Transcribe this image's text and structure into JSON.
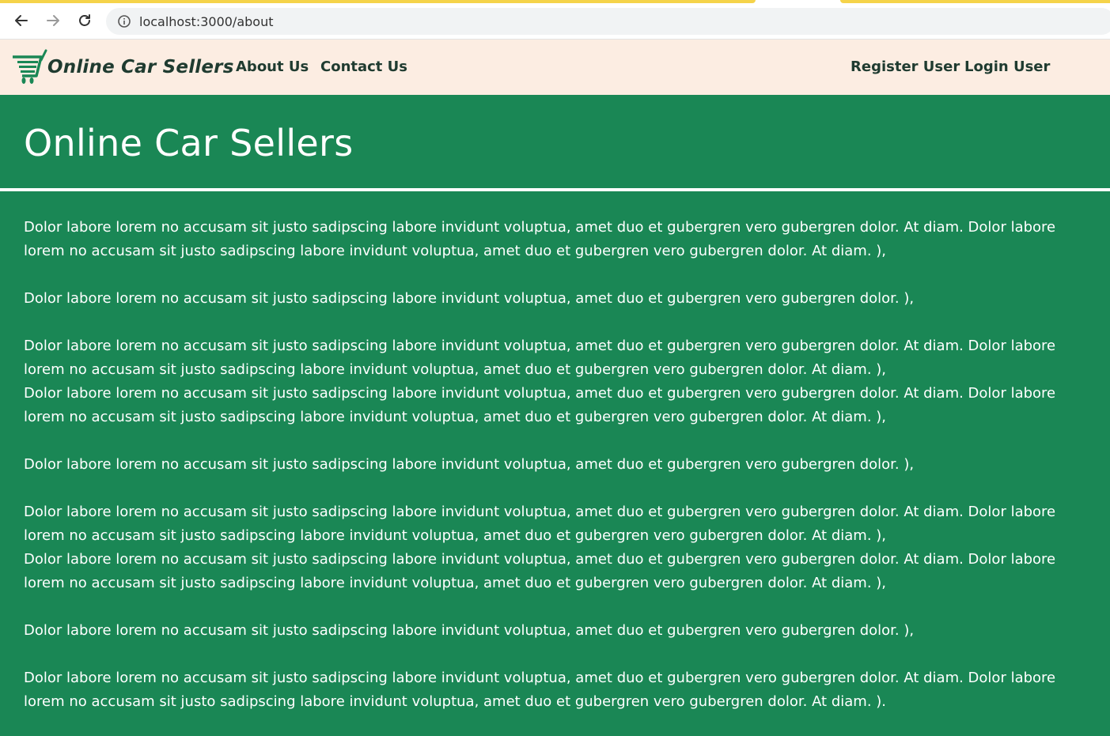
{
  "browser": {
    "url": "localhost:3000/about"
  },
  "navbar": {
    "brand": "Online Car Sellers",
    "links": {
      "about": "About Us",
      "contact": "Contact Us",
      "register": "Register User",
      "login": "Login User"
    }
  },
  "hero": {
    "title": "Online Car Sellers"
  },
  "content": {
    "paragraphs": [
      "Dolor labore lorem no accusam sit justo sadipscing labore invidunt voluptua, amet duo et gubergren vero gubergren dolor. At diam. Dolor labore lorem no accusam sit justo sadipscing labore invidunt voluptua, amet duo et gubergren vero gubergren dolor. At diam. ),",
      "Dolor labore lorem no accusam sit justo sadipscing labore invidunt voluptua, amet duo et gubergren vero gubergren dolor. ),",
      "Dolor labore lorem no accusam sit justo sadipscing labore invidunt voluptua, amet duo et gubergren vero gubergren dolor. At diam. Dolor labore lorem no accusam sit justo sadipscing labore invidunt voluptua, amet duo et gubergren vero gubergren dolor. At diam. ),",
      "Dolor labore lorem no accusam sit justo sadipscing labore invidunt voluptua, amet duo et gubergren vero gubergren dolor. At diam. Dolor labore lorem no accusam sit justo sadipscing labore invidunt voluptua, amet duo et gubergren vero gubergren dolor. At diam. ),",
      "Dolor labore lorem no accusam sit justo sadipscing labore invidunt voluptua, amet duo et gubergren vero gubergren dolor. ),",
      "Dolor labore lorem no accusam sit justo sadipscing labore invidunt voluptua, amet duo et gubergren vero gubergren dolor. At diam. Dolor labore lorem no accusam sit justo sadipscing labore invidunt voluptua, amet duo et gubergren vero gubergren dolor. At diam. ),",
      "Dolor labore lorem no accusam sit justo sadipscing labore invidunt voluptua, amet duo et gubergren vero gubergren dolor. At diam. Dolor labore lorem no accusam sit justo sadipscing labore invidunt voluptua, amet duo et gubergren vero gubergren dolor. At diam. ),",
      "Dolor labore lorem no accusam sit justo sadipscing labore invidunt voluptua, amet duo et gubergren vero gubergren dolor. ),",
      "Dolor labore lorem no accusam sit justo sadipscing labore invidunt voluptua, amet duo et gubergren vero gubergren dolor. At diam. Dolor labore lorem no accusam sit justo sadipscing labore invidunt voluptua, amet duo et gubergren vero gubergren dolor. At diam. )."
    ]
  },
  "colors": {
    "primary_green": "#1a8755",
    "navbar_bg": "#fcede2",
    "nav_text": "#1f3b30",
    "loading_bar": "#f5d34a"
  }
}
